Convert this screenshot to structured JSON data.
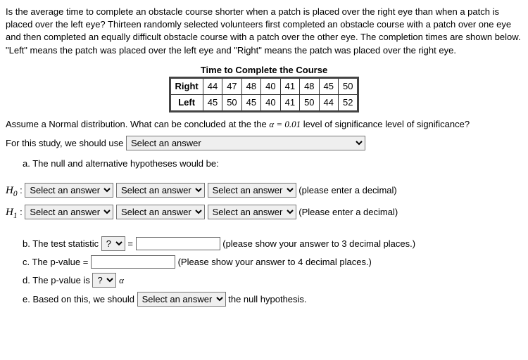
{
  "problem_statement": "Is the average time to complete an obstacle course shorter when a patch is placed over the right eye than when a patch is placed over the left eye? Thirteen randomly selected volunteers first completed an obstacle course with a patch over one eye and then completed an equally difficult obstacle course with a patch over the other eye. The completion times are shown below. \"Left\" means the patch was placed over the left eye and \"Right\" means the patch was placed over the right eye.",
  "table": {
    "title": "Time to Complete the Course",
    "row_labels": {
      "right": "Right",
      "left": "Left"
    },
    "right_values": [
      "44",
      "47",
      "48",
      "40",
      "41",
      "48",
      "45",
      "50"
    ],
    "left_values": [
      "45",
      "50",
      "45",
      "40",
      "41",
      "50",
      "44",
      "52"
    ]
  },
  "assume_line_prefix": "Assume a Normal distribution.  What can be concluded at the the ",
  "alpha_value": "α = 0.01",
  "assume_line_suffix": " level of significance level of significance?",
  "study_prefix": "For this study, we should use ",
  "select_placeholder": "Select an answer",
  "q_placeholder": "?",
  "parts": {
    "a": "a. The null and alternative hypotheses would be:",
    "h0_label": "H",
    "h0_sub": "0",
    "h1_label": "H",
    "h1_sub": "1",
    "decimal_hint_lower": "(please enter a decimal)",
    "decimal_hint_upper": "(Please enter a decimal)",
    "b_prefix": "b. The test statistic ",
    "b_equals": " = ",
    "b_hint": " (please show your answer to 3 decimal places.)",
    "c_prefix": "c. The p-value = ",
    "c_hint": " (Please show your answer to 4 decimal places.)",
    "d_prefix": "d. The p-value is ",
    "d_alpha": " α",
    "e_prefix": "e. Based on this, we should ",
    "e_suffix": " the null hypothesis."
  }
}
